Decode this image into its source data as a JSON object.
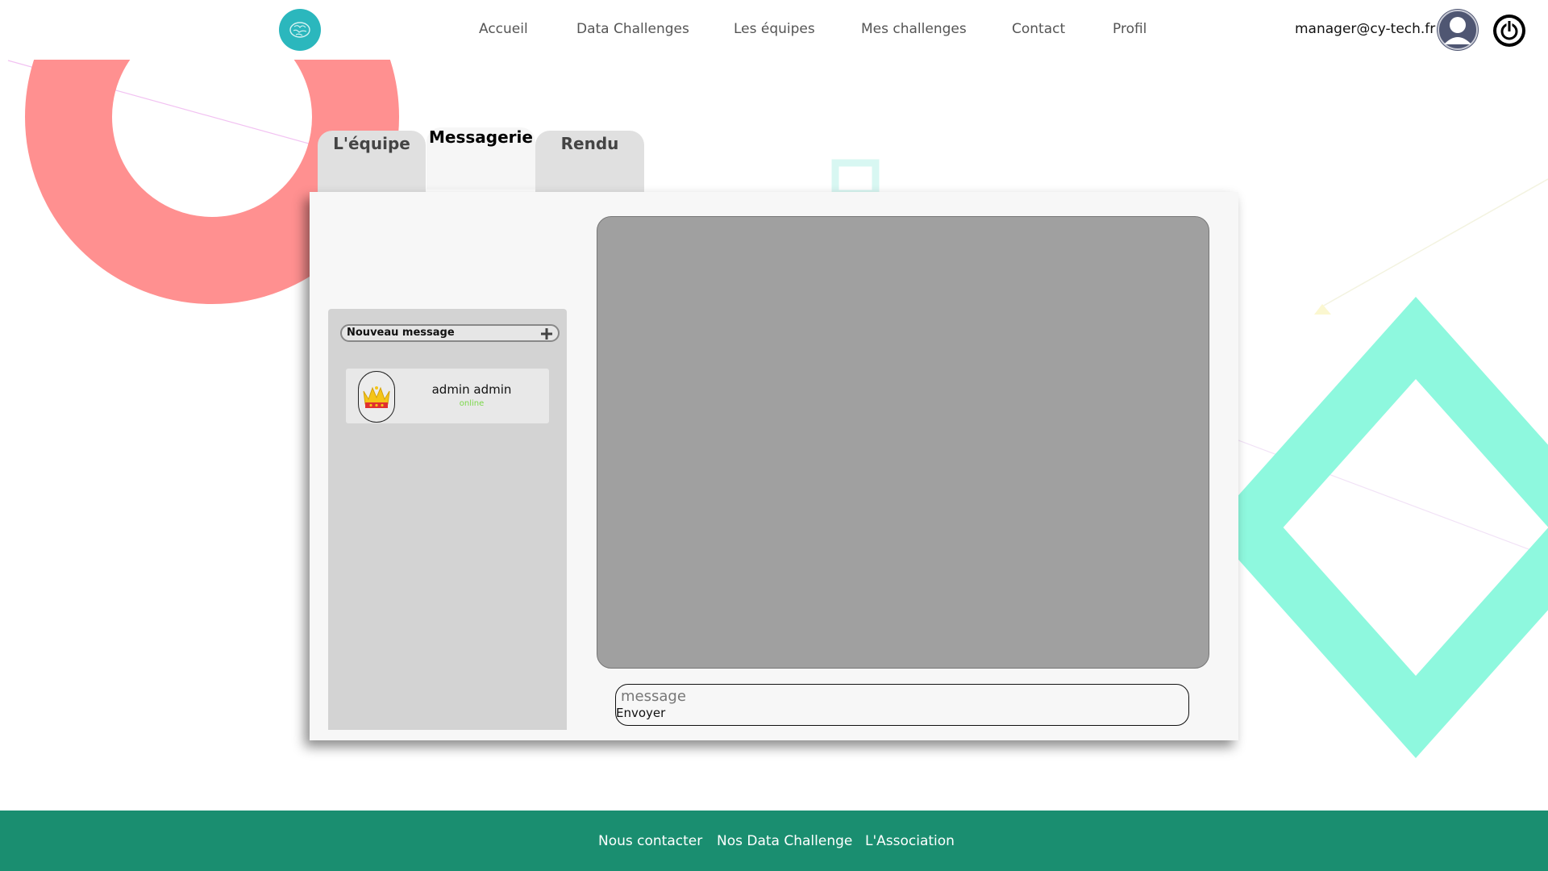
{
  "header": {
    "nav": [
      {
        "label": "Accueil"
      },
      {
        "label": "Data Challenges"
      },
      {
        "label": "Les équipes"
      },
      {
        "label": "Mes challenges"
      },
      {
        "label": "Contact"
      },
      {
        "label": "Profil"
      }
    ],
    "user_email": "manager@cy-tech.fr",
    "icons": {
      "logo": "brain-logo-icon",
      "avatar": "user-avatar-icon",
      "power": "power-icon"
    }
  },
  "tabs": [
    {
      "label": "L'équipe",
      "active": false
    },
    {
      "label": "Messagerie",
      "active": true
    },
    {
      "label": "Rendu",
      "active": false
    }
  ],
  "messaging": {
    "new_message_label": "Nouveau message",
    "contacts": [
      {
        "name": "admin admin",
        "status": "online",
        "icon": "crown-icon"
      }
    ],
    "composer": {
      "placeholder": "message",
      "send_label": "Envoyer"
    }
  },
  "footer": {
    "links": [
      {
        "label": "Nous contacter"
      },
      {
        "label": "Nos Data Challenge"
      },
      {
        "label": "L'Association"
      }
    ]
  },
  "colors": {
    "footer": "#1a8e70",
    "logo": "#2bb7bd",
    "deco_ring": "#ff9090",
    "deco_diamond": "#8ef8de",
    "online": "#7bd84a"
  }
}
